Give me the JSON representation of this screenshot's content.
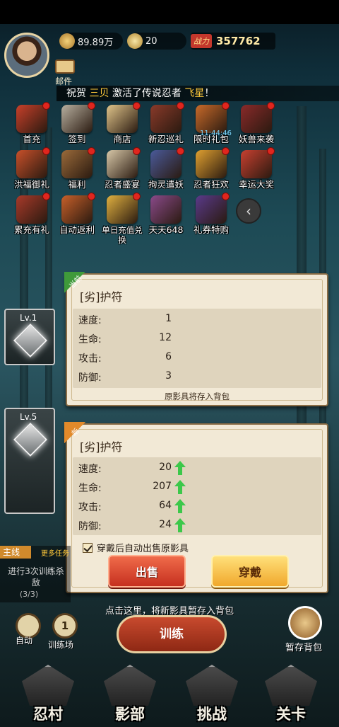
{
  "header": {
    "coins": "89.89万",
    "gems": "20",
    "power_label": "战力",
    "power_value": "357762",
    "mail_label": "邮件"
  },
  "notice": {
    "prefix": "祝贺",
    "player": "三贝",
    "middle": "激活了传说忍者",
    "ninja": "飞星",
    "suffix": "！"
  },
  "icons": [
    {
      "label": "首充",
      "dot": true
    },
    {
      "label": "签到",
      "dot": true
    },
    {
      "label": "商店",
      "dot": true
    },
    {
      "label": "新忍巡礼",
      "dot": true
    },
    {
      "label": "限时礼包",
      "dot": true,
      "timer": "11:44:46"
    },
    {
      "label": "妖兽来袭",
      "dot": true
    },
    {
      "label": "洪福御礼",
      "dot": true
    },
    {
      "label": "福利",
      "dot": true
    },
    {
      "label": "忍者盛宴",
      "dot": true
    },
    {
      "label": "拘灵遣妖",
      "dot": true
    },
    {
      "label": "忍者狂欢",
      "dot": true
    },
    {
      "label": "幸运大奖",
      "dot": true
    },
    {
      "label": "累充有礼",
      "dot": true
    },
    {
      "label": "自动返利",
      "dot": true
    },
    {
      "label": "单日充值兑换",
      "dot": true
    },
    {
      "label": "天天648",
      "dot": false
    },
    {
      "label": "礼券特购",
      "dot": true
    }
  ],
  "slots": [
    {
      "lv": "Lv.1"
    },
    {
      "lv": "Lv.5"
    }
  ],
  "current_card": {
    "ribbon": "当前",
    "title": "[劣]护符",
    "stats": [
      {
        "k": "速度:",
        "v": "1"
      },
      {
        "k": "生命:",
        "v": "12"
      },
      {
        "k": "攻击:",
        "v": "6"
      },
      {
        "k": "防御:",
        "v": "3"
      }
    ],
    "note": "原影具将存入背包"
  },
  "new_card": {
    "ribbon": "新",
    "title": "[劣]护符",
    "stats": [
      {
        "k": "速度:",
        "v": "20"
      },
      {
        "k": "生命:",
        "v": "207"
      },
      {
        "k": "攻击:",
        "v": "64"
      },
      {
        "k": "防御:",
        "v": "24"
      }
    ],
    "checkbox": "穿戴后自动出售原影具",
    "sell": "出售",
    "equip": "穿戴"
  },
  "quest": {
    "tag": "主线",
    "more": "更多任务",
    "desc": "进行3次训练杀敌",
    "count": "(3/3)"
  },
  "hint": "点击这里，将新影具暂存入背包",
  "train": "训练",
  "auto": {
    "icon": "",
    "label": "自动"
  },
  "trainfield": {
    "icon": "1",
    "label": "训练场"
  },
  "bag_label": "暂存背包",
  "nav": [
    "忍村",
    "影部",
    "挑战",
    "关卡"
  ],
  "colors": {
    "accent": "#ffc93a",
    "up_arrow": "#3cc84a",
    "sell": "#d8402a",
    "equip": "#f5b840"
  }
}
